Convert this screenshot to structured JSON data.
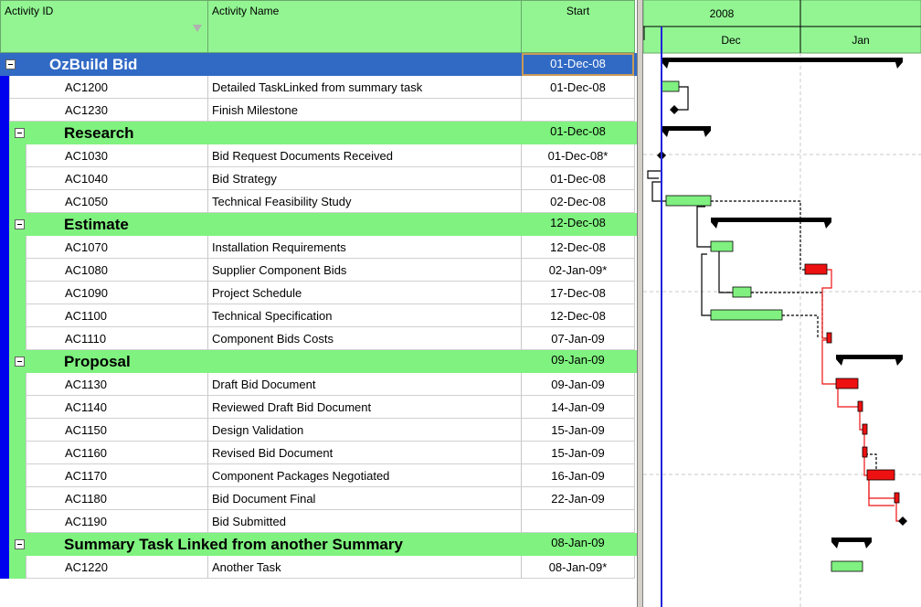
{
  "columns": {
    "activity_id": "Activity ID",
    "activity_name": "Activity Name",
    "start": "Start"
  },
  "timescale": {
    "year": "2008",
    "months": [
      "Dec",
      "Jan"
    ]
  },
  "rows": [
    {
      "type": "wbs",
      "level": 0,
      "name": "OzBuild Bid",
      "start": "01-Dec-08"
    },
    {
      "type": "act",
      "level": 1,
      "id": "AC1200",
      "name": "Detailed TaskLinked from summary task",
      "start": "01-Dec-08"
    },
    {
      "type": "act",
      "level": 1,
      "id": "AC1230",
      "name": "Finish Milestone",
      "start": ""
    },
    {
      "type": "wbs",
      "level": 1,
      "name": "Research",
      "start": "01-Dec-08"
    },
    {
      "type": "act",
      "level": 2,
      "id": "AC1030",
      "name": "Bid Request Documents Received",
      "start": "01-Dec-08*"
    },
    {
      "type": "act",
      "level": 2,
      "id": "AC1040",
      "name": "Bid Strategy",
      "start": "01-Dec-08"
    },
    {
      "type": "act",
      "level": 2,
      "id": "AC1050",
      "name": "Technical Feasibility Study",
      "start": "02-Dec-08"
    },
    {
      "type": "wbs",
      "level": 1,
      "name": "Estimate",
      "start": "12-Dec-08"
    },
    {
      "type": "act",
      "level": 2,
      "id": "AC1070",
      "name": "Installation Requirements",
      "start": "12-Dec-08"
    },
    {
      "type": "act",
      "level": 2,
      "id": "AC1080",
      "name": "Supplier Component Bids",
      "start": "02-Jan-09*"
    },
    {
      "type": "act",
      "level": 2,
      "id": "AC1090",
      "name": "Project Schedule",
      "start": "17-Dec-08"
    },
    {
      "type": "act",
      "level": 2,
      "id": "AC1100",
      "name": "Technical Specification",
      "start": "12-Dec-08"
    },
    {
      "type": "act",
      "level": 2,
      "id": "AC1110",
      "name": "Component Bids Costs",
      "start": "07-Jan-09"
    },
    {
      "type": "wbs",
      "level": 1,
      "name": "Proposal",
      "start": "09-Jan-09"
    },
    {
      "type": "act",
      "level": 2,
      "id": "AC1130",
      "name": "Draft Bid Document",
      "start": "09-Jan-09"
    },
    {
      "type": "act",
      "level": 2,
      "id": "AC1140",
      "name": "Reviewed Draft Bid Document",
      "start": "14-Jan-09"
    },
    {
      "type": "act",
      "level": 2,
      "id": "AC1150",
      "name": "Design Validation",
      "start": "15-Jan-09"
    },
    {
      "type": "act",
      "level": 2,
      "id": "AC1160",
      "name": "Revised Bid Document",
      "start": "15-Jan-09"
    },
    {
      "type": "act",
      "level": 2,
      "id": "AC1170",
      "name": "Component Packages Negotiated",
      "start": "16-Jan-09"
    },
    {
      "type": "act",
      "level": 2,
      "id": "AC1180",
      "name": "Bid Document Final",
      "start": "22-Jan-09"
    },
    {
      "type": "act",
      "level": 2,
      "id": "AC1190",
      "name": "Bid Submitted",
      "start": ""
    },
    {
      "type": "wbs",
      "level": 1,
      "name": "Summary Task Linked from another Summary",
      "start": "08-Jan-09"
    },
    {
      "type": "act",
      "level": 2,
      "id": "AC1220",
      "name": "Another Task",
      "start": "08-Jan-09*"
    }
  ],
  "colors": {
    "header_green": "#92f592",
    "wbs_blue": "#316ac5",
    "wbs_green": "#7ff27f",
    "band_blue": "#0000ee",
    "noncritical_bar": "#80f080",
    "critical_bar": "#ee1111",
    "data_date_line": "#2222dd",
    "summary_bar": "#000000"
  },
  "gantt": {
    "timeline_start": "2008-11-27",
    "timeline_end": "2009-01-28",
    "data_date": "2008-12-01",
    "summary_bars": [
      {
        "row": 0,
        "start": "2008-12-01",
        "end": "2009-01-24"
      },
      {
        "row": 3,
        "start": "2008-12-01",
        "end": "2008-12-12"
      },
      {
        "row": 7,
        "start": "2008-12-12",
        "end": "2009-01-08"
      },
      {
        "row": 13,
        "start": "2009-01-09",
        "end": "2009-01-24"
      },
      {
        "row": 21,
        "start": "2009-01-08",
        "end": "2009-01-17"
      }
    ],
    "task_bars": [
      {
        "row": 1,
        "start": "2008-12-01",
        "end": "2008-12-05",
        "critical": false
      },
      {
        "row": 6,
        "start": "2008-12-02",
        "end": "2008-12-12",
        "critical": false
      },
      {
        "row": 8,
        "start": "2008-12-12",
        "end": "2008-12-17",
        "critical": false
      },
      {
        "row": 9,
        "start": "2009-01-02",
        "end": "2009-01-07",
        "critical": true
      },
      {
        "row": 10,
        "start": "2008-12-17",
        "end": "2008-12-21",
        "critical": false
      },
      {
        "row": 11,
        "start": "2008-12-12",
        "end": "2008-12-28",
        "critical": false
      },
      {
        "row": 12,
        "start": "2009-01-07",
        "end": "2009-01-08",
        "critical": true
      },
      {
        "row": 14,
        "start": "2009-01-09",
        "end": "2009-01-14",
        "critical": true
      },
      {
        "row": 15,
        "start": "2009-01-14",
        "end": "2009-01-15",
        "critical": true
      },
      {
        "row": 16,
        "start": "2009-01-15",
        "end": "2009-01-16",
        "critical": true
      },
      {
        "row": 17,
        "start": "2009-01-15",
        "end": "2009-01-16",
        "critical": true
      },
      {
        "row": 18,
        "start": "2009-01-16",
        "end": "2009-01-22",
        "critical": true
      },
      {
        "row": 19,
        "start": "2009-01-22",
        "end": "2009-01-23",
        "critical": true
      },
      {
        "row": 22,
        "start": "2009-01-08",
        "end": "2009-01-15",
        "critical": false
      }
    ],
    "milestones": [
      {
        "row": 2,
        "date": "2008-12-04"
      },
      {
        "row": 4,
        "date": "2008-12-01"
      },
      {
        "row": 20,
        "date": "2009-01-24"
      }
    ]
  }
}
